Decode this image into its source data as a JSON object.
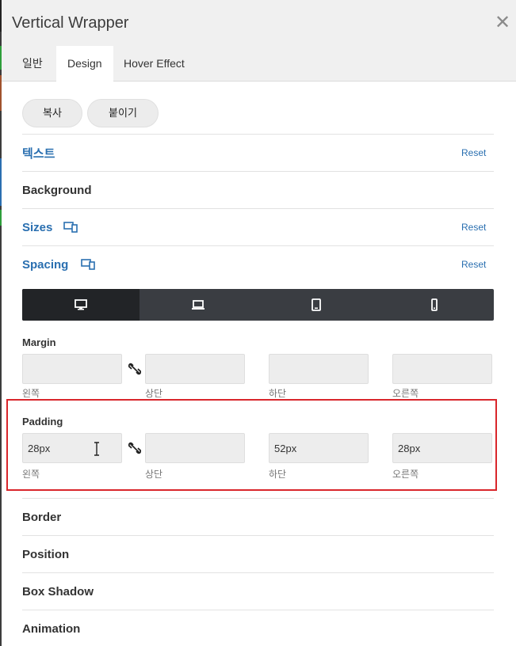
{
  "title": "Vertical Wrapper",
  "tabs": [
    {
      "label": "일반"
    },
    {
      "label": "Design"
    },
    {
      "label": "Hover Effect"
    }
  ],
  "buttons": {
    "copy": "복사",
    "paste": "붙이기"
  },
  "sections": {
    "text": {
      "label": "텍스트",
      "reset": "Reset"
    },
    "background": {
      "label": "Background"
    },
    "sizes": {
      "label": "Sizes",
      "reset": "Reset"
    },
    "spacing": {
      "label": "Spacing",
      "reset": "Reset"
    },
    "border": {
      "label": "Border"
    },
    "position": {
      "label": "Position"
    },
    "box_shadow": {
      "label": "Box Shadow"
    },
    "animation": {
      "label": "Animation"
    }
  },
  "devices": [
    {
      "name": "desktop-icon",
      "active": true
    },
    {
      "name": "laptop-icon",
      "active": false
    },
    {
      "name": "tablet-icon",
      "active": false
    },
    {
      "name": "phone-icon",
      "active": false
    }
  ],
  "margin": {
    "label": "Margin",
    "left": {
      "value": "",
      "sublabel": "왼쪽"
    },
    "top": {
      "value": "",
      "sublabel": "상단"
    },
    "bottom": {
      "value": "",
      "sublabel": "하단"
    },
    "right": {
      "value": "",
      "sublabel": "오른쪽"
    }
  },
  "padding": {
    "label": "Padding",
    "left": {
      "value": "28px",
      "sublabel": "왼쪽"
    },
    "top": {
      "value": "",
      "sublabel": "상단"
    },
    "bottom": {
      "value": "52px",
      "sublabel": "하단"
    },
    "right": {
      "value": "28px",
      "sublabel": "오른쪽"
    }
  },
  "colors": {
    "accent": "#2a6fb0",
    "highlight": "#d9262b",
    "device_bar": "#3a3d42",
    "device_active": "#222427"
  }
}
